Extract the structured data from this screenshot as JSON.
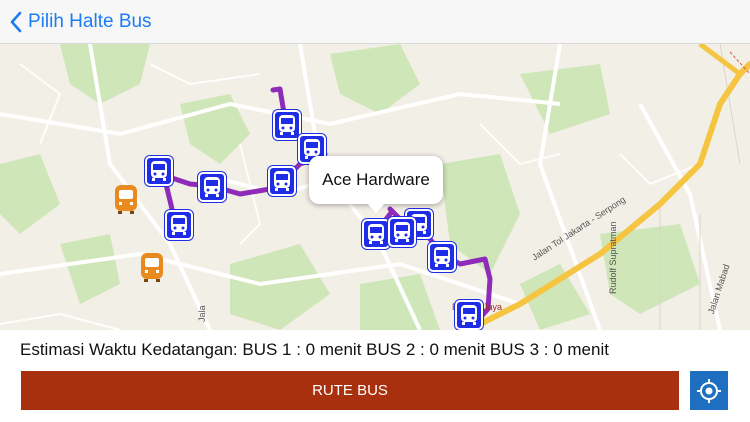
{
  "nav": {
    "back_label": "Pilih Halte Bus"
  },
  "map": {
    "callout_label": "Ace Hardware",
    "road_labels": {
      "toll": "Jalan Tol Jakarta - Serpong",
      "rudolf": "Rudolf Supratman",
      "mabad": "Jalan Mabad",
      "jala": "Jala",
      "bintaro": "Bintaro Jaya",
      "bintaro2": "Xc"
    },
    "colors": {
      "route": "#8e2bb8",
      "bus_blue": "#1f2ee6",
      "bus_orange": "#e88a1e",
      "toll": "#f5c542"
    }
  },
  "footer": {
    "eta_text": "Estimasi Waktu Kedatangan:  BUS 1 : 0 menit BUS 2 : 0 menit BUS 3 : 0 menit",
    "route_button": "RUTE BUS",
    "locate_icon": "locate-icon"
  }
}
